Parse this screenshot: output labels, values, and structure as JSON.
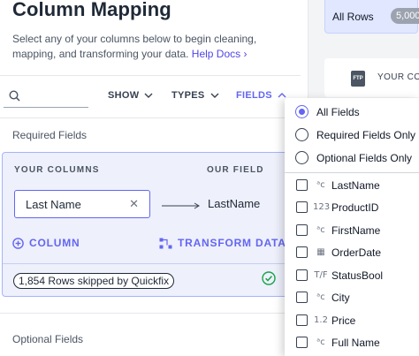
{
  "header": {
    "title": "Column Mapping",
    "description": "Select any of your columns below to begin cleaning, mapping, and transforming your data.",
    "help_link": "Help Docs ›"
  },
  "toolbar": {
    "search_placeholder": "",
    "show_label": "SHOW",
    "types_label": "TYPES",
    "fields_label": "FIELDS"
  },
  "required_section": {
    "label": "Required Fields",
    "your_columns_header": "YOUR COLUMNS",
    "our_field_header": "OUR FIELD",
    "selected_column": "Last Name",
    "mapped_field": "LastName",
    "add_column_label": "COLUMN",
    "transform_label": "TRANSFORM DATA",
    "skipped_text": "1,854 Rows skipped by Quickfix"
  },
  "optional_section": {
    "label": "Optional Fields"
  },
  "right_panel": {
    "all_rows_label": "All Rows",
    "all_rows_count": "5,000",
    "your_columns_label": "YOUR COLU",
    "file_icon_text": "FTP"
  },
  "dropdown": {
    "radio_options": [
      {
        "label": "All Fields",
        "selected": true
      },
      {
        "label": "Required Fields Only",
        "selected": false
      },
      {
        "label": "Optional Fields Only",
        "selected": false
      }
    ],
    "fields": [
      {
        "type_glyph": "ᵃc",
        "type": "text-icon",
        "name": "LastName"
      },
      {
        "type_glyph": "123",
        "type": "number-icon",
        "name": "ProductID"
      },
      {
        "type_glyph": "ᵃc",
        "type": "text-icon",
        "name": "FirstName"
      },
      {
        "type_glyph": "▦",
        "type": "date-icon",
        "name": "OrderDate"
      },
      {
        "type_glyph": "T/F",
        "type": "boolean-icon",
        "name": "StatusBool"
      },
      {
        "type_glyph": "ᵃc",
        "type": "text-icon",
        "name": "City"
      },
      {
        "type_glyph": "1.2",
        "type": "decimal-icon",
        "name": "Price"
      },
      {
        "type_glyph": "ᵃc",
        "type": "text-icon",
        "name": "Full Name"
      }
    ]
  },
  "colors": {
    "accent": "#6366f1",
    "card_bg": "#eef0fb",
    "success": "#16a34a"
  }
}
